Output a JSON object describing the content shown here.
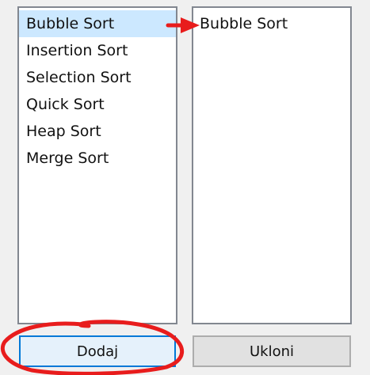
{
  "available_list": {
    "items": [
      "Bubble Sort",
      "Insertion Sort",
      "Selection Sort",
      "Quick Sort",
      "Heap Sort",
      "Merge Sort"
    ],
    "selected_index": 0
  },
  "chosen_list": {
    "items": [
      "Bubble Sort"
    ]
  },
  "buttons": {
    "add_label": "Dodaj",
    "remove_label": "Ukloni"
  },
  "annotations": {
    "arrow_color": "#e81c1c",
    "circle_color": "#e81c1c"
  },
  "colors": {
    "selection_bg": "#cce8ff",
    "focus_border": "#0078d7"
  }
}
